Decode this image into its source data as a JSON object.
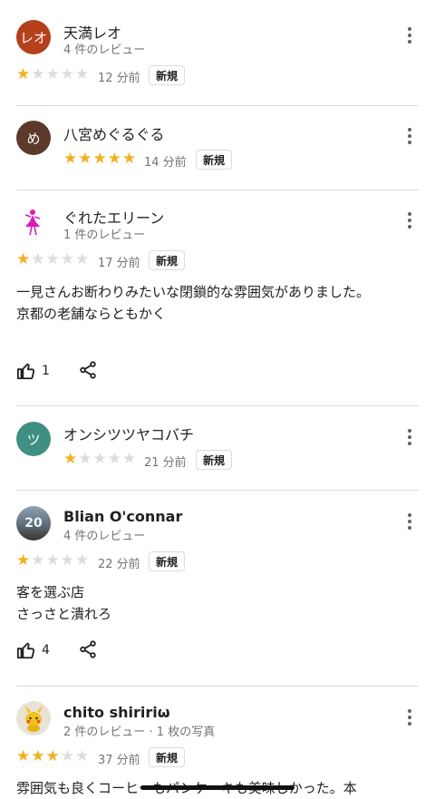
{
  "reviews": [
    {
      "name": "天満レオ",
      "avatar_text": "レオ",
      "avatar_color": "#b5401c",
      "sub": "4 件のレビュー",
      "rating": 1,
      "time": "12 分前",
      "badge": "新規",
      "body": "",
      "likes": ""
    },
    {
      "name": "八宮めぐるぐる",
      "avatar_text": "め",
      "avatar_color": "#5b3a2c",
      "sub": "",
      "rating": 5,
      "time": "14 分前",
      "badge": "新規",
      "body": "",
      "likes": ""
    },
    {
      "name": "ぐれたエリーン",
      "avatar_text": "",
      "avatar_color": "#ffffff",
      "sub": "1 件のレビュー",
      "rating": 1,
      "time": "17 分前",
      "badge": "新規",
      "body": "一見さんお断わりみたいな閉鎖的な雰囲気がありました。\n京都の老舗ならともかく",
      "likes": "1"
    },
    {
      "name": "オンシツツヤコバチ",
      "avatar_text": "ツ",
      "avatar_color": "#3f8f82",
      "sub": "",
      "rating": 1,
      "time": "21 分前",
      "badge": "新規",
      "body": "",
      "likes": ""
    },
    {
      "name": "Blian O'connar",
      "avatar_text": "20",
      "avatar_color": "#6f7f8c",
      "sub": "4 件のレビュー",
      "rating": 1,
      "time": "22 分前",
      "badge": "新規",
      "body": "客を選ぶ店\nさっさと潰れろ",
      "likes": "4"
    },
    {
      "name": "chito shiririω",
      "avatar_text": "",
      "avatar_color": "#e9e2d6",
      "sub": "2 件のレビュー · 1 枚の写真",
      "rating": 3,
      "time": "37 分前",
      "badge": "新規",
      "body": "雰囲気も良くコーヒーもパンケーキも美味しかった。本",
      "likes": ""
    }
  ],
  "icons": {
    "more": "more-vert-icon",
    "like": "thumb-up-icon",
    "share": "share-icon"
  },
  "colors": {
    "star_on": "#f2b01e",
    "star_off": "#dadce0"
  }
}
